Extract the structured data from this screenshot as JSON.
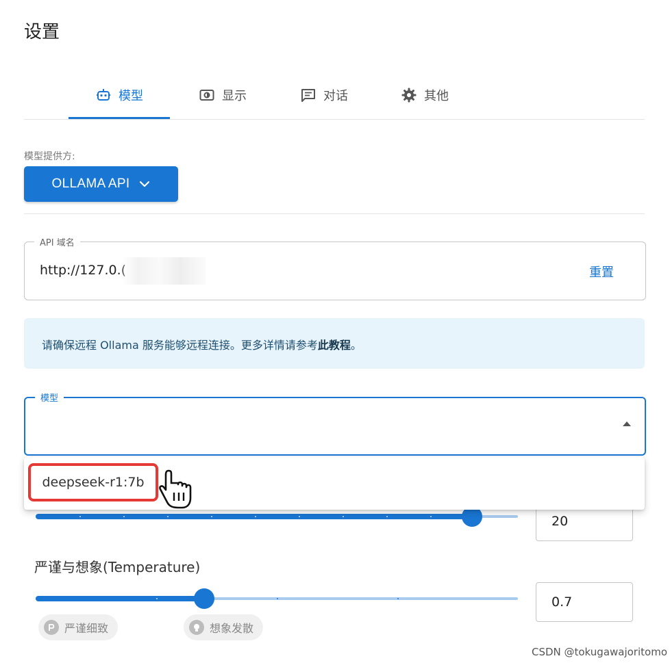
{
  "page": {
    "title": "设置"
  },
  "tabs": [
    {
      "label": "模型",
      "icon": "robot-icon",
      "active": true
    },
    {
      "label": "显示",
      "icon": "display-icon",
      "active": false
    },
    {
      "label": "对话",
      "icon": "chat-icon",
      "active": false
    },
    {
      "label": "其他",
      "icon": "gear-icon",
      "active": false
    }
  ],
  "provider": {
    "label": "模型提供方:",
    "selected": "OLLAMA API"
  },
  "api": {
    "legend": "API 域名",
    "value": "http://127.0.(",
    "reset_label": "重置"
  },
  "info": {
    "text": "请确保远程 Ollama 服务能够远程连接。更多详情请参考",
    "link": "此教程",
    "suffix": "。"
  },
  "model": {
    "legend": "模型",
    "value": ""
  },
  "model_menu": {
    "options": [
      "deepseek-r1:7b"
    ]
  },
  "slider_top": {
    "value": "20",
    "fraction": 0.905
  },
  "temperature": {
    "label": "严谨与想象(Temperature)",
    "value": "0.7",
    "fraction": 0.35,
    "chips": [
      {
        "label": "严谨细致",
        "icon": "strict-icon"
      },
      {
        "label": "想象发散",
        "icon": "lightbulb-icon"
      }
    ]
  },
  "colors": {
    "accent": "#1976d2",
    "highlight": "#e53935",
    "info_bg": "#e8f4fb"
  },
  "watermark": "CSDN @tokugawajoritomo"
}
